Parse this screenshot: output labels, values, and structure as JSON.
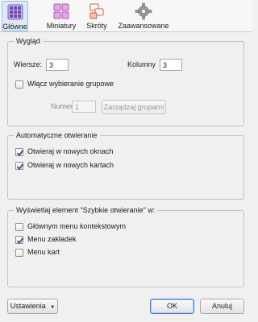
{
  "tabs": [
    {
      "label": "Główne",
      "icon": "grid-icon",
      "active": true
    },
    {
      "label": "Miniatury",
      "icon": "thumbnails-icon",
      "active": false
    },
    {
      "label": "Skróty",
      "icon": "shortcuts-icon",
      "active": false
    },
    {
      "label": "Zaawansowane",
      "icon": "gear-icon",
      "active": false
    }
  ],
  "appearance": {
    "legend": "Wygląd",
    "rows_label": "Wiersze:",
    "rows_value": "3",
    "columns_label": "Kolumny",
    "columns_value": "3",
    "group_select_label": "Włącz wybieranie grupowe",
    "group_select_checked": false,
    "group_number_label": "Numer grup:",
    "group_number_value": "1",
    "manage_groups_label": "Zarządzaj grupami"
  },
  "auto_open": {
    "legend": "Automatyczne otwieranie",
    "new_windows_label": "Otwieraj w nowych oknach",
    "new_windows_checked": true,
    "new_tabs_label": "Otwieraj w nowych kartach",
    "new_tabs_checked": true
  },
  "show_element": {
    "legend": "Wyświetlaj element \"Szybkie otwieranie\" w:",
    "context_menu_label": "Głównym menu kontekstowym",
    "context_menu_checked": false,
    "bookmarks_menu_label": "Menu zakładek",
    "bookmarks_menu_checked": true,
    "tabs_menu_label": "Menu kart",
    "tabs_menu_checked": false
  },
  "footer": {
    "settings_label": "Ustawienia",
    "ok_label": "OK",
    "cancel_label": "Anuluj"
  },
  "colors": {
    "active_tab_bg": "#dde9f6",
    "default_button_border": "#3d7bd6"
  }
}
